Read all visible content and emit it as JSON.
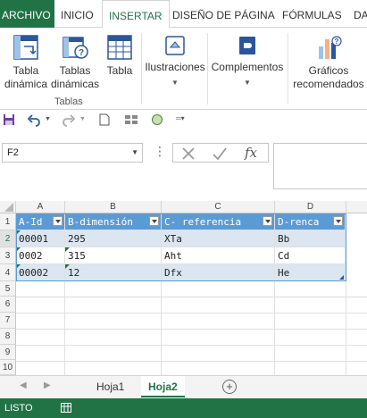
{
  "ribbon_tabs": [
    "ARCHIVO",
    "INICIO",
    "INSERTAR",
    "DISEÑO DE PÁGINA",
    "FÓRMULAS",
    "DA"
  ],
  "ribbon": {
    "tabla_dinamica": "Tabla dinámica",
    "tablas_dinamicas": "Tablas dinámicas",
    "tabla": "Tabla",
    "group_tablas": "Tablas",
    "ilustraciones": "Ilustraciones",
    "complementos": "Complementos",
    "graficos": "Gráficos recomendados"
  },
  "namebox": {
    "value": "F2"
  },
  "formula": {
    "fx": "fx",
    "value": ""
  },
  "columns": [
    "A",
    "B",
    "C",
    "D"
  ],
  "rows": [
    "1",
    "2",
    "3",
    "4",
    "5",
    "6",
    "7",
    "8",
    "9",
    "10"
  ],
  "table": {
    "headers": [
      "A-Id",
      "B-dimensión",
      "C- referencia",
      "D-renca"
    ],
    "data": [
      [
        "00001",
        "295",
        "XTa",
        "Bb"
      ],
      [
        "0002",
        "315",
        "Aht",
        "Cd"
      ],
      [
        "00002",
        "12",
        "Dfx",
        "He"
      ]
    ]
  },
  "sheets": [
    "Hoja1",
    "Hoja2"
  ],
  "active_sheet": "Hoja2",
  "status": {
    "text": "LISTO"
  },
  "colors": {
    "accent": "#217346",
    "table_header": "#5b9bd5",
    "table_band": "#dce6f1"
  }
}
